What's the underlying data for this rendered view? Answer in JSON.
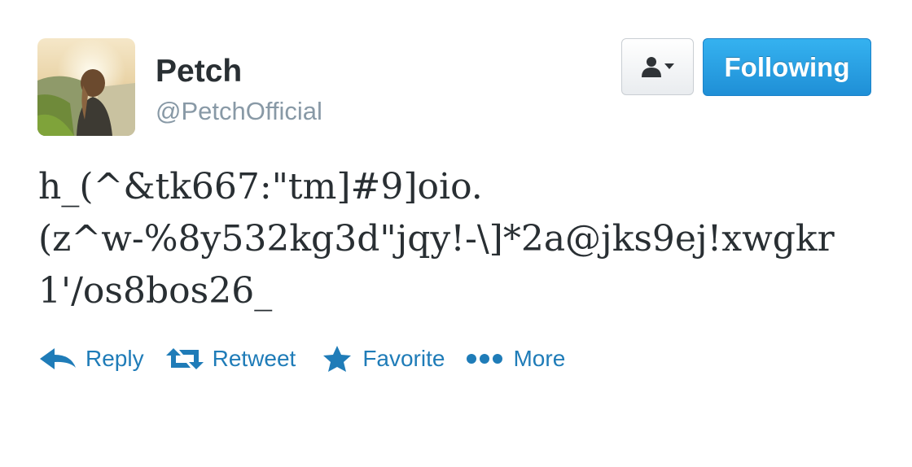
{
  "user": {
    "display_name": "Petch",
    "handle": "@PetchOfficial",
    "avatar": "profile-photo"
  },
  "buttons": {
    "user_menu_icon": "person-dropdown-icon",
    "follow_label": "Following"
  },
  "tweet": {
    "lines": [
      "h_(^&tk667:\"tm]#9]oio.",
      "(z^w-%8y532kg3d\"jqy!-\\]*2a@jks9ej!xwgkr",
      "1'/os8bos26_"
    ]
  },
  "actions": {
    "reply": "Reply",
    "retweet": "Retweet",
    "favorite": "Favorite",
    "more": "More"
  },
  "colors": {
    "accent": "#1f7cb8",
    "follow_button": "#2aa1e6",
    "text": "#292f33",
    "muted": "#8899a6"
  }
}
